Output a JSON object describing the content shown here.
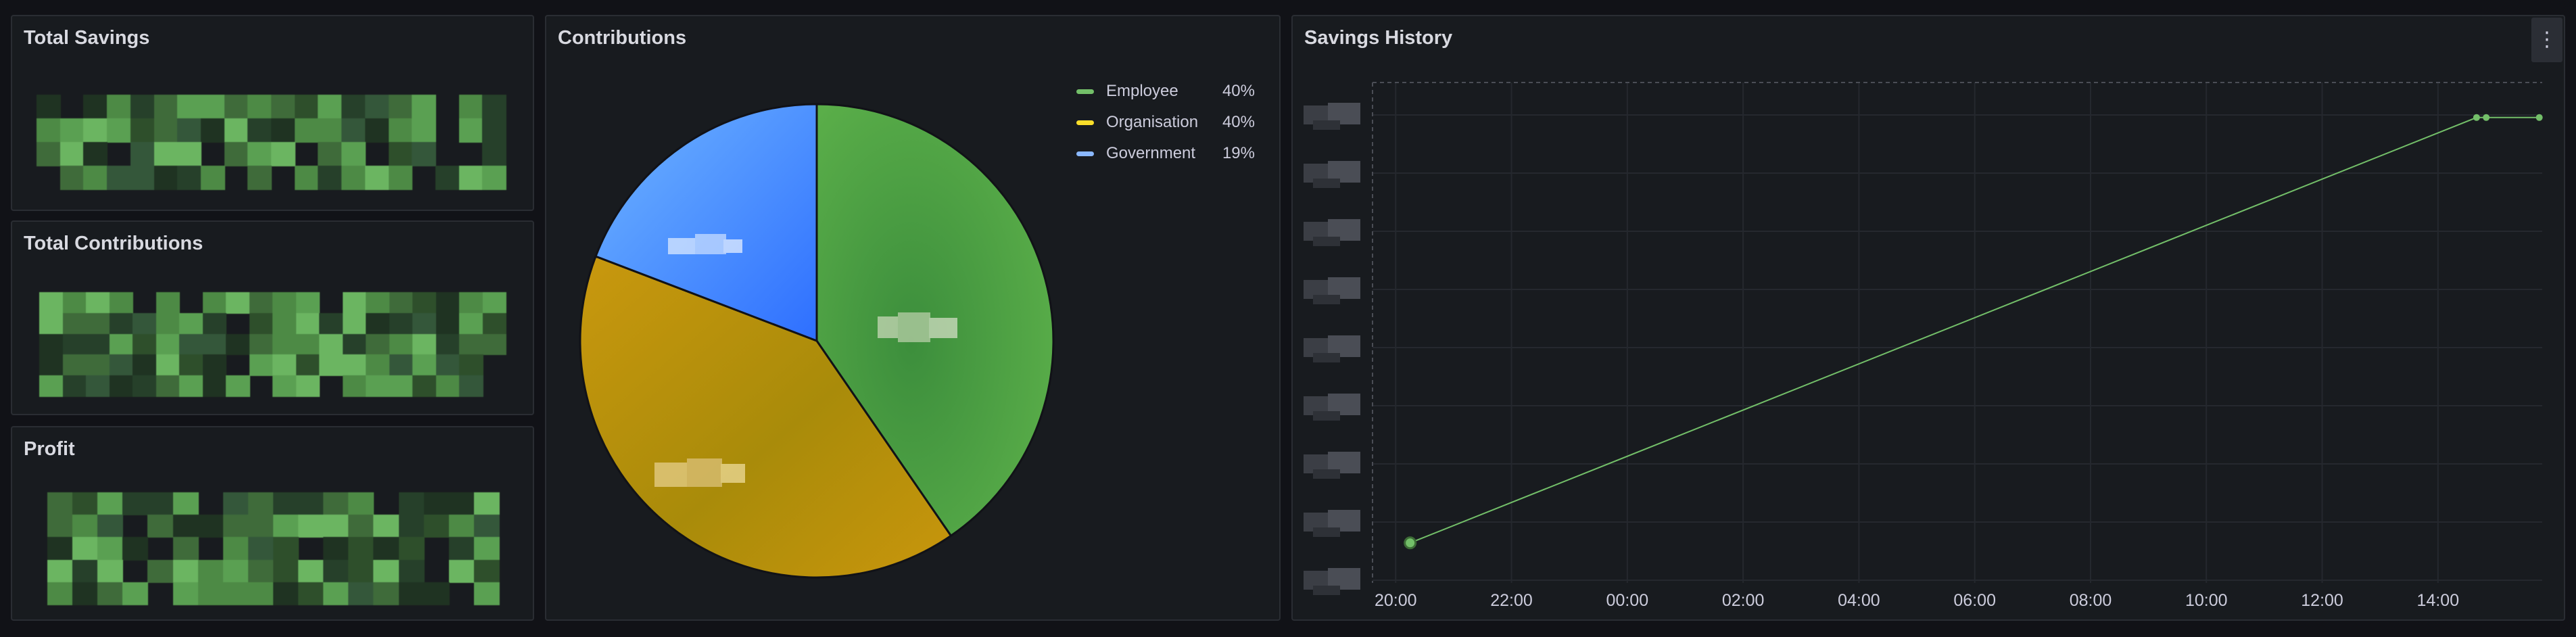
{
  "panels": {
    "total_savings": {
      "title": "Total Savings"
    },
    "total_contributions": {
      "title": "Total Contributions"
    },
    "profit": {
      "title": "Profit"
    },
    "contributions": {
      "title": "Contributions",
      "legend": [
        {
          "name": "Employee",
          "percent": "40%",
          "color": "#73bf69"
        },
        {
          "name": "Organisation",
          "percent": "40%",
          "color": "#fade2a"
        },
        {
          "name": "Government",
          "percent": "19%",
          "color": "#8ab8ff"
        }
      ]
    },
    "savings_history": {
      "title": "Savings History",
      "menu_icon": "kebab-menu-icon",
      "x_ticks": [
        "20:00",
        "22:00",
        "00:00",
        "02:00",
        "04:00",
        "06:00",
        "08:00",
        "10:00",
        "12:00",
        "14:00"
      ]
    }
  },
  "colors": {
    "employee": "#73bf69",
    "organisation": "#fade2a",
    "government": "#8ab8ff",
    "series": "#73bf69",
    "background": "#111217",
    "panel": "#181b1f"
  },
  "chart_data": [
    {
      "type": "pie",
      "title": "Contributions",
      "categories": [
        "Employee",
        "Organisation",
        "Government"
      ],
      "values": [
        40,
        40,
        19
      ]
    },
    {
      "type": "line",
      "title": "Savings History",
      "x": [
        "20:15",
        "14:40",
        "14:50",
        "15:45"
      ],
      "series": [
        {
          "values": [
            0.08,
            0.93,
            0.93,
            0.93
          ]
        }
      ],
      "note_ylim": [
        0,
        1
      ]
    }
  ]
}
